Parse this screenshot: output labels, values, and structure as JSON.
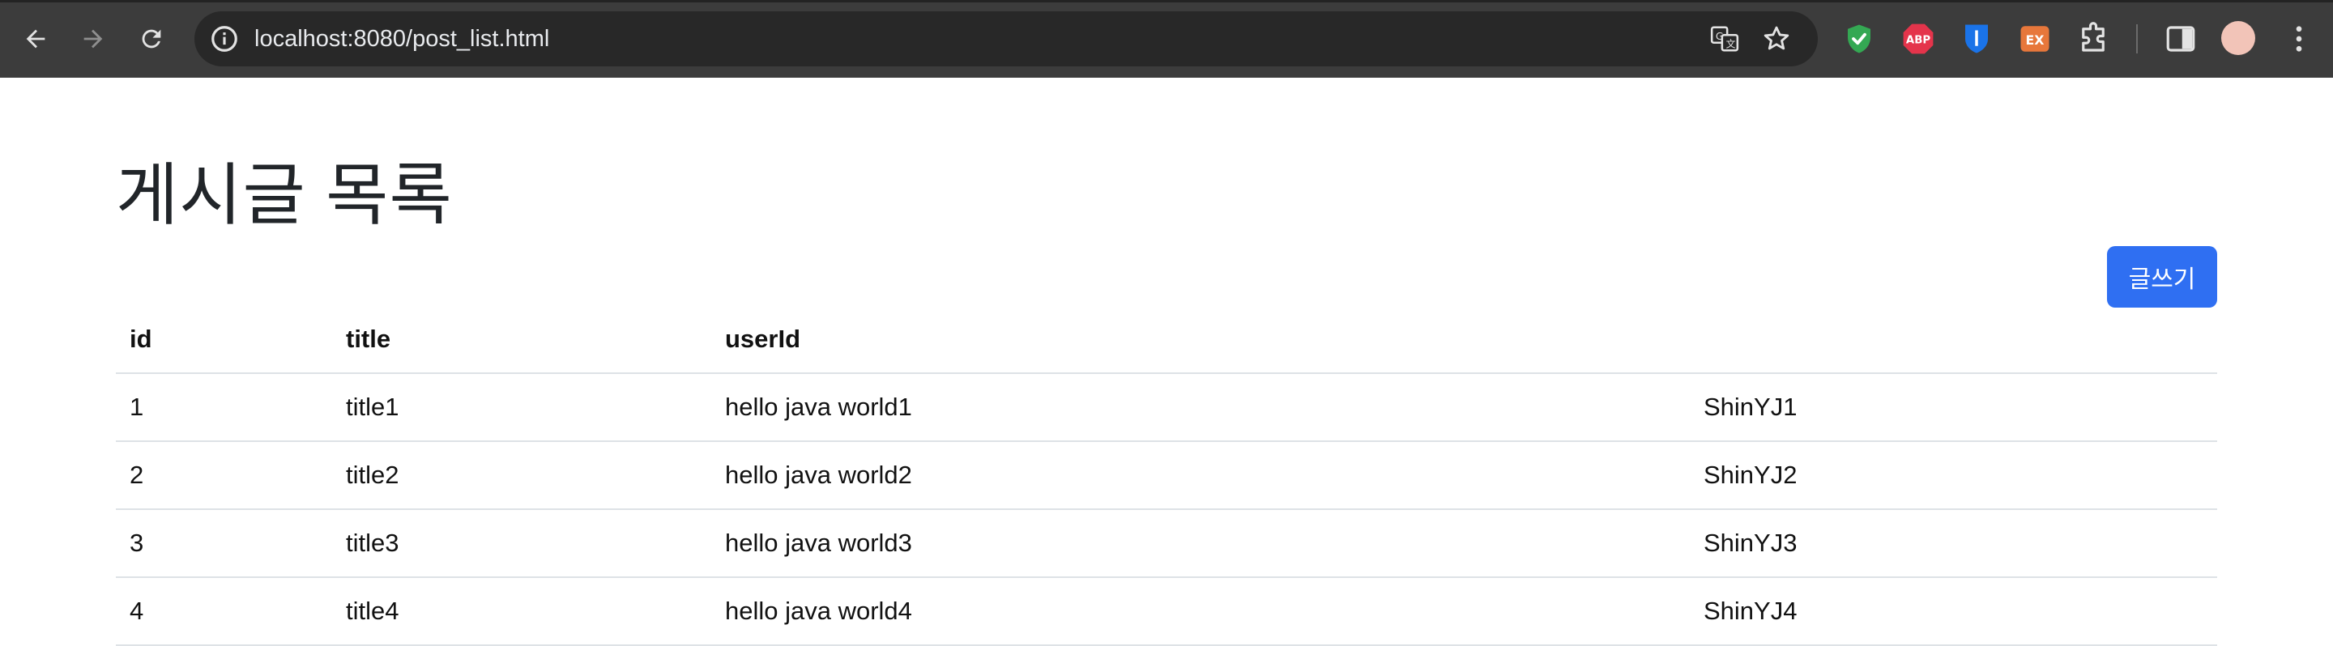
{
  "browser": {
    "url": "localhost:8080/post_list.html",
    "icons": {
      "back": "arrow-left-icon",
      "forward": "arrow-right-icon",
      "reload": "reload-icon",
      "site_info": "info-icon",
      "translate": "translate-icon",
      "bookmark": "star-icon",
      "side_panel": "side-panel-icon",
      "menu": "kebab-menu-icon"
    },
    "extensions": [
      {
        "name": "shield-check-extension",
        "color": "#34a853"
      },
      {
        "name": "adblock-plus-extension",
        "label": "ABP",
        "color": "#e4344b"
      },
      {
        "name": "bitwarden-extension",
        "color": "#1a73e8"
      },
      {
        "name": "ex-extension",
        "label": "EX",
        "color": "#e7773b"
      },
      {
        "name": "puzzle-extensions-menu"
      }
    ]
  },
  "page": {
    "title": "게시글 목록",
    "write_button": "글쓰기",
    "accent_color": "#2f6ff2"
  },
  "table": {
    "headers": [
      "id",
      "title",
      "userId"
    ],
    "rows": [
      {
        "id": "1",
        "title": "title1",
        "content": "hello java world1",
        "userId": "ShinYJ1"
      },
      {
        "id": "2",
        "title": "title2",
        "content": "hello java world2",
        "userId": "ShinYJ2"
      },
      {
        "id": "3",
        "title": "title3",
        "content": "hello java world3",
        "userId": "ShinYJ3"
      },
      {
        "id": "4",
        "title": "title4",
        "content": "hello java world4",
        "userId": "ShinYJ4"
      }
    ]
  }
}
